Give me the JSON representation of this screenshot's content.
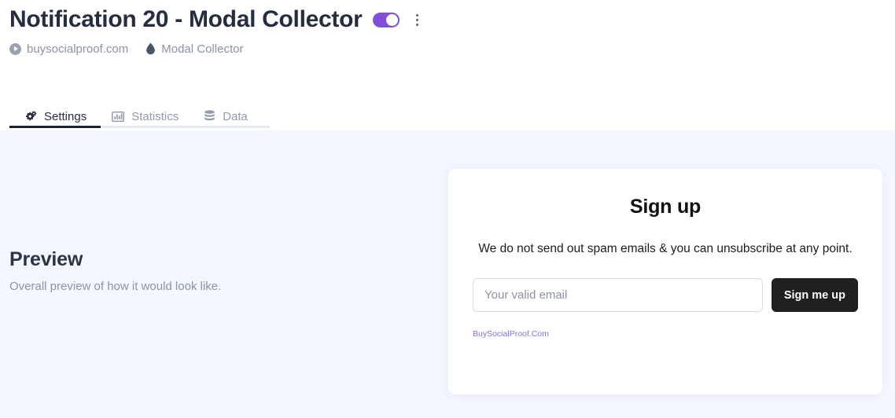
{
  "header": {
    "title": "Notification 20 - Modal Collector",
    "toggle": {
      "name": "notification-enabled-toggle",
      "state": "on",
      "color": "#8050d8"
    },
    "kebab_menu_label": "More options",
    "breadcrumb": [
      {
        "icon": "site-globe-icon",
        "label": "buysocialproof.com"
      },
      {
        "icon": "water-drop-icon",
        "label": "Modal Collector"
      }
    ]
  },
  "tabs": [
    {
      "icon": "gears-icon",
      "label": "Settings",
      "active": true
    },
    {
      "icon": "bar-chart-icon",
      "label": "Statistics",
      "active": false
    },
    {
      "icon": "database-icon",
      "label": "Data",
      "active": false
    }
  ],
  "preview": {
    "title": "Preview",
    "subtitle": "Overall preview of how it would look like."
  },
  "modal": {
    "title": "Sign up",
    "description": "We do not send out spam emails & you can unsubscribe at any point.",
    "email_placeholder": "Your valid email",
    "email_value": "",
    "submit_label": "Sign me up",
    "footer_link": "BuySocialProof.Com"
  },
  "colors": {
    "accent_purple": "#8050d8",
    "page_background": "#f4f7fd",
    "header_background": "#ffffff",
    "active_tab_underline": "#1b2233",
    "button_dark": "#201f21",
    "link_purple": "#8a6fd8"
  }
}
